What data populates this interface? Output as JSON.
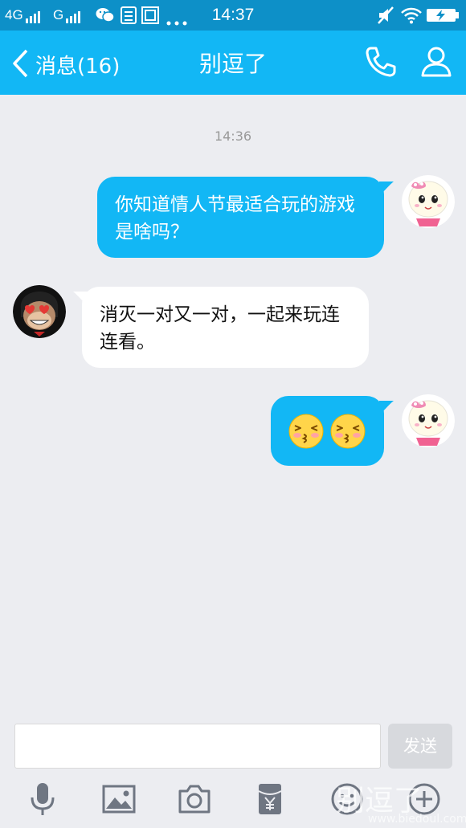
{
  "status_bar": {
    "signal_1": "4G",
    "signal_2": "G",
    "time": "14:37",
    "icons": [
      "signal-bars-icon",
      "wechat-icon",
      "notification-icon",
      "screenshot-icon",
      "more-dots-icon",
      "mute-icon",
      "wifi-icon",
      "battery-charging-icon"
    ]
  },
  "header": {
    "back_label": "消息(16)",
    "title": "别逗了",
    "actions": [
      "phone-icon",
      "contact-icon"
    ],
    "background": "#12b7f5"
  },
  "messages": [
    {
      "type": "timestamp",
      "text": "14:36"
    },
    {
      "type": "outgoing",
      "text": "你知道情人节最适合玩的游戏是啥吗？",
      "avatar": "girl-avatar"
    },
    {
      "type": "incoming",
      "text": "消灭一对又一对，一起来玩连连看。",
      "avatar": "monkey-avatar"
    },
    {
      "type": "outgoing",
      "emoji": [
        "kiss-emoji",
        "kiss-emoji"
      ],
      "avatar": "girl-avatar"
    }
  ],
  "composer": {
    "input_value": "",
    "send_label": "发送",
    "tools": [
      "microphone-icon",
      "image-icon",
      "camera-icon",
      "red-packet-icon",
      "emoji-icon",
      "plus-icon"
    ]
  },
  "watermark": {
    "text": "别逗了",
    "url": "www.biedoul.com"
  },
  "colors": {
    "accent": "#12b7f5",
    "outgoing_bubble": "#12b7f5",
    "incoming_bubble": "#ffffff",
    "background": "#ecedf1"
  }
}
